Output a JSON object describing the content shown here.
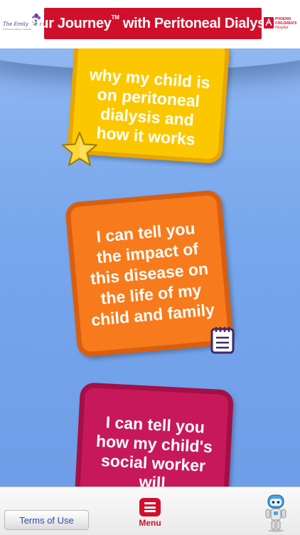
{
  "header": {
    "title": "Our Journey",
    "title_mark": "TM",
    "title_rest": " with Peritoneal Dialysis",
    "left_logo_text": "The Emily Center",
    "left_logo_subtext": "at Phoenix Children's Hospital",
    "right_logo_line1": "PHOENIX",
    "right_logo_line2": "CHILDREN'S",
    "right_logo_line3": "Hospital"
  },
  "cards": [
    {
      "text": "why my child is on peritoneal dialysis and how it works",
      "color": "#fbc800"
    },
    {
      "text": "I can tell you the impact of this disease on the life of my child and family",
      "color": "#f77b1c"
    },
    {
      "text": "I can tell you how my child's social worker will",
      "color": "#c7195a"
    }
  ],
  "tabbar": {
    "terms_label": "Terms of Use",
    "menu_label": "Menu",
    "accent_color": "#d0102b"
  },
  "icons": [
    "star-icon",
    "notepad-icon",
    "menu-icon",
    "robot-mascot-icon"
  ]
}
